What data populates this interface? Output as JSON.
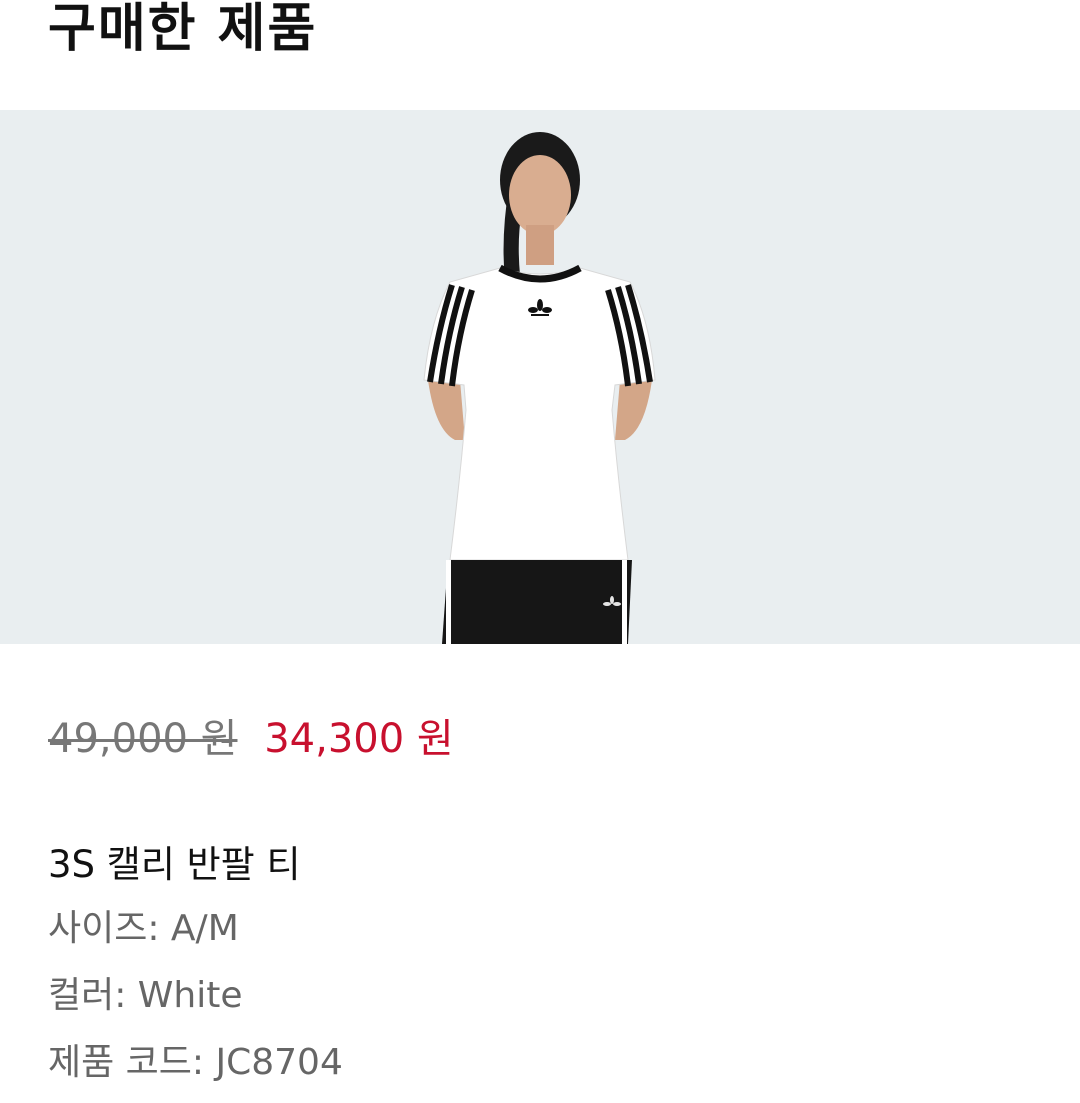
{
  "header": {
    "title": "구매한 제품"
  },
  "image": {
    "alt": "3S 캘리 반팔 티"
  },
  "price": {
    "original": "49,000 원",
    "sale": "34,300 원",
    "sale_color": "#c8102e"
  },
  "product": {
    "name": "3S 캘리 반팔 티",
    "size_label": "사이즈: A/M",
    "color_label": "컬러: White",
    "code_label": "제품 코드: JC8704"
  }
}
